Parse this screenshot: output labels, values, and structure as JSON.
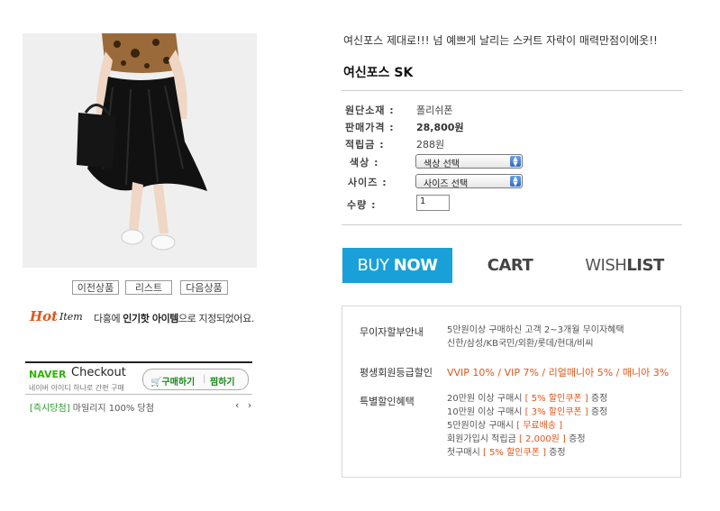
{
  "nav": {
    "prev": "이전상품",
    "list": "리스트",
    "next": "다음상품"
  },
  "hot": {
    "hot": "Hot",
    "item": "Item",
    "desc_pre": "다홍에 ",
    "desc_bold": "인기핫 아이템",
    "desc_post": "으로 지정되었어요."
  },
  "naver": {
    "brand": "NAVER",
    "checkout": "Checkout",
    "sub": "네이버 아이디 하나로 간편 구매",
    "buy": "구매하기",
    "wish": "찜하기",
    "promo_tag": "[즉시당첨]",
    "promo": " 마일리지 100% 당첨",
    "arrows": "‹ ›"
  },
  "product": {
    "summary": "여신포스 제대로!!! 넘 예쁘게 날리는 스커트 자락이 매력만점이에옷!!",
    "name": "여신포스 SK"
  },
  "specs": {
    "material_label": "원단소재 :",
    "material": "폴리쉬폰",
    "price_label": "판매가격 :",
    "price": "28,800원",
    "points_label": "적립금 :",
    "points": "288원",
    "color_label": "색상 :",
    "color_value": "색상 선택",
    "size_label": "사이즈 :",
    "size_value": "사이즈 선택",
    "qty_label": "수량 :",
    "qty_value": "1"
  },
  "actions": {
    "buy_pre": "BUY ",
    "buy_bold": "NOW",
    "cart": "CART",
    "wish_pre": "WISH",
    "wish_bold": "LIST"
  },
  "benefits": {
    "interest_label": "무이자할부안내",
    "interest_line1": "5만원이상 구매하신 고객 2~3개월 무이자혜택",
    "interest_line2": "신한/삼성/KB국민/외환/롯데/현대/비씨",
    "member_label": "평생회원등급할인",
    "member_grades": "VVIP 10% / VIP 7% / 리얼매니아 5% / 매니아 3%",
    "special_label": "특별할인혜택",
    "special": [
      {
        "pre": "20만원 이상 구매시 ",
        "hl": "[ 5% 할인쿠폰 ]",
        "post": " 증정"
      },
      {
        "pre": "10만원 이상 구매시 ",
        "hl": "[ 3% 할인쿠폰 ]",
        "post": " 증정"
      },
      {
        "pre": "5만원이상 구매시 ",
        "hl": "[ 무료배송 ]",
        "post": ""
      },
      {
        "pre": "회원가입시 적립금 ",
        "hl": "[ 2,000원 ]",
        "post": " 증정"
      },
      {
        "pre": "첫구매시 ",
        "hl": "[ 5% 할인쿠폰 ]",
        "post": " 증정"
      }
    ]
  },
  "colors": {
    "accent_blue": "#1aa0d8",
    "highlight_orange": "#e0561a",
    "naver_green": "#2db400"
  }
}
